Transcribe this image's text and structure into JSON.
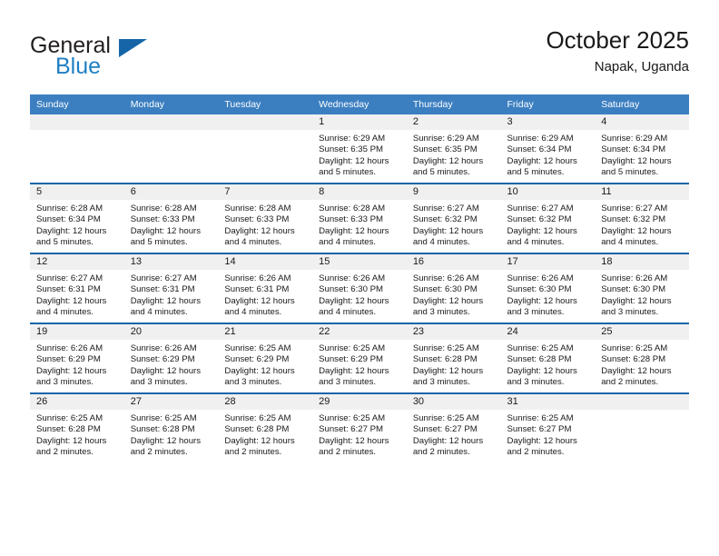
{
  "brand": {
    "name_top": "General",
    "name_bottom": "Blue",
    "triangle_color": "#1565a8",
    "blue_text_color": "#1f7fc4"
  },
  "header": {
    "title": "October 2025",
    "subtitle": "Napak, Uganda"
  },
  "theme": {
    "header_row_bg": "#3c7fc1",
    "row_border": "#1565a8",
    "daynum_band_bg": "#f0f0f0",
    "text": "#1a1a1a"
  },
  "weekdays": [
    "Sunday",
    "Monday",
    "Tuesday",
    "Wednesday",
    "Thursday",
    "Friday",
    "Saturday"
  ],
  "weeks": [
    [
      {
        "day": "",
        "sunrise": "",
        "sunset": "",
        "daylight1": "",
        "daylight2": ""
      },
      {
        "day": "",
        "sunrise": "",
        "sunset": "",
        "daylight1": "",
        "daylight2": ""
      },
      {
        "day": "",
        "sunrise": "",
        "sunset": "",
        "daylight1": "",
        "daylight2": ""
      },
      {
        "day": "1",
        "sunrise": "Sunrise: 6:29 AM",
        "sunset": "Sunset: 6:35 PM",
        "daylight1": "Daylight: 12 hours",
        "daylight2": "and 5 minutes."
      },
      {
        "day": "2",
        "sunrise": "Sunrise: 6:29 AM",
        "sunset": "Sunset: 6:35 PM",
        "daylight1": "Daylight: 12 hours",
        "daylight2": "and 5 minutes."
      },
      {
        "day": "3",
        "sunrise": "Sunrise: 6:29 AM",
        "sunset": "Sunset: 6:34 PM",
        "daylight1": "Daylight: 12 hours",
        "daylight2": "and 5 minutes."
      },
      {
        "day": "4",
        "sunrise": "Sunrise: 6:29 AM",
        "sunset": "Sunset: 6:34 PM",
        "daylight1": "Daylight: 12 hours",
        "daylight2": "and 5 minutes."
      }
    ],
    [
      {
        "day": "5",
        "sunrise": "Sunrise: 6:28 AM",
        "sunset": "Sunset: 6:34 PM",
        "daylight1": "Daylight: 12 hours",
        "daylight2": "and 5 minutes."
      },
      {
        "day": "6",
        "sunrise": "Sunrise: 6:28 AM",
        "sunset": "Sunset: 6:33 PM",
        "daylight1": "Daylight: 12 hours",
        "daylight2": "and 5 minutes."
      },
      {
        "day": "7",
        "sunrise": "Sunrise: 6:28 AM",
        "sunset": "Sunset: 6:33 PM",
        "daylight1": "Daylight: 12 hours",
        "daylight2": "and 4 minutes."
      },
      {
        "day": "8",
        "sunrise": "Sunrise: 6:28 AM",
        "sunset": "Sunset: 6:33 PM",
        "daylight1": "Daylight: 12 hours",
        "daylight2": "and 4 minutes."
      },
      {
        "day": "9",
        "sunrise": "Sunrise: 6:27 AM",
        "sunset": "Sunset: 6:32 PM",
        "daylight1": "Daylight: 12 hours",
        "daylight2": "and 4 minutes."
      },
      {
        "day": "10",
        "sunrise": "Sunrise: 6:27 AM",
        "sunset": "Sunset: 6:32 PM",
        "daylight1": "Daylight: 12 hours",
        "daylight2": "and 4 minutes."
      },
      {
        "day": "11",
        "sunrise": "Sunrise: 6:27 AM",
        "sunset": "Sunset: 6:32 PM",
        "daylight1": "Daylight: 12 hours",
        "daylight2": "and 4 minutes."
      }
    ],
    [
      {
        "day": "12",
        "sunrise": "Sunrise: 6:27 AM",
        "sunset": "Sunset: 6:31 PM",
        "daylight1": "Daylight: 12 hours",
        "daylight2": "and 4 minutes."
      },
      {
        "day": "13",
        "sunrise": "Sunrise: 6:27 AM",
        "sunset": "Sunset: 6:31 PM",
        "daylight1": "Daylight: 12 hours",
        "daylight2": "and 4 minutes."
      },
      {
        "day": "14",
        "sunrise": "Sunrise: 6:26 AM",
        "sunset": "Sunset: 6:31 PM",
        "daylight1": "Daylight: 12 hours",
        "daylight2": "and 4 minutes."
      },
      {
        "day": "15",
        "sunrise": "Sunrise: 6:26 AM",
        "sunset": "Sunset: 6:30 PM",
        "daylight1": "Daylight: 12 hours",
        "daylight2": "and 4 minutes."
      },
      {
        "day": "16",
        "sunrise": "Sunrise: 6:26 AM",
        "sunset": "Sunset: 6:30 PM",
        "daylight1": "Daylight: 12 hours",
        "daylight2": "and 3 minutes."
      },
      {
        "day": "17",
        "sunrise": "Sunrise: 6:26 AM",
        "sunset": "Sunset: 6:30 PM",
        "daylight1": "Daylight: 12 hours",
        "daylight2": "and 3 minutes."
      },
      {
        "day": "18",
        "sunrise": "Sunrise: 6:26 AM",
        "sunset": "Sunset: 6:30 PM",
        "daylight1": "Daylight: 12 hours",
        "daylight2": "and 3 minutes."
      }
    ],
    [
      {
        "day": "19",
        "sunrise": "Sunrise: 6:26 AM",
        "sunset": "Sunset: 6:29 PM",
        "daylight1": "Daylight: 12 hours",
        "daylight2": "and 3 minutes."
      },
      {
        "day": "20",
        "sunrise": "Sunrise: 6:26 AM",
        "sunset": "Sunset: 6:29 PM",
        "daylight1": "Daylight: 12 hours",
        "daylight2": "and 3 minutes."
      },
      {
        "day": "21",
        "sunrise": "Sunrise: 6:25 AM",
        "sunset": "Sunset: 6:29 PM",
        "daylight1": "Daylight: 12 hours",
        "daylight2": "and 3 minutes."
      },
      {
        "day": "22",
        "sunrise": "Sunrise: 6:25 AM",
        "sunset": "Sunset: 6:29 PM",
        "daylight1": "Daylight: 12 hours",
        "daylight2": "and 3 minutes."
      },
      {
        "day": "23",
        "sunrise": "Sunrise: 6:25 AM",
        "sunset": "Sunset: 6:28 PM",
        "daylight1": "Daylight: 12 hours",
        "daylight2": "and 3 minutes."
      },
      {
        "day": "24",
        "sunrise": "Sunrise: 6:25 AM",
        "sunset": "Sunset: 6:28 PM",
        "daylight1": "Daylight: 12 hours",
        "daylight2": "and 3 minutes."
      },
      {
        "day": "25",
        "sunrise": "Sunrise: 6:25 AM",
        "sunset": "Sunset: 6:28 PM",
        "daylight1": "Daylight: 12 hours",
        "daylight2": "and 2 minutes."
      }
    ],
    [
      {
        "day": "26",
        "sunrise": "Sunrise: 6:25 AM",
        "sunset": "Sunset: 6:28 PM",
        "daylight1": "Daylight: 12 hours",
        "daylight2": "and 2 minutes."
      },
      {
        "day": "27",
        "sunrise": "Sunrise: 6:25 AM",
        "sunset": "Sunset: 6:28 PM",
        "daylight1": "Daylight: 12 hours",
        "daylight2": "and 2 minutes."
      },
      {
        "day": "28",
        "sunrise": "Sunrise: 6:25 AM",
        "sunset": "Sunset: 6:28 PM",
        "daylight1": "Daylight: 12 hours",
        "daylight2": "and 2 minutes."
      },
      {
        "day": "29",
        "sunrise": "Sunrise: 6:25 AM",
        "sunset": "Sunset: 6:27 PM",
        "daylight1": "Daylight: 12 hours",
        "daylight2": "and 2 minutes."
      },
      {
        "day": "30",
        "sunrise": "Sunrise: 6:25 AM",
        "sunset": "Sunset: 6:27 PM",
        "daylight1": "Daylight: 12 hours",
        "daylight2": "and 2 minutes."
      },
      {
        "day": "31",
        "sunrise": "Sunrise: 6:25 AM",
        "sunset": "Sunset: 6:27 PM",
        "daylight1": "Daylight: 12 hours",
        "daylight2": "and 2 minutes."
      },
      {
        "day": "",
        "sunrise": "",
        "sunset": "",
        "daylight1": "",
        "daylight2": ""
      }
    ]
  ]
}
